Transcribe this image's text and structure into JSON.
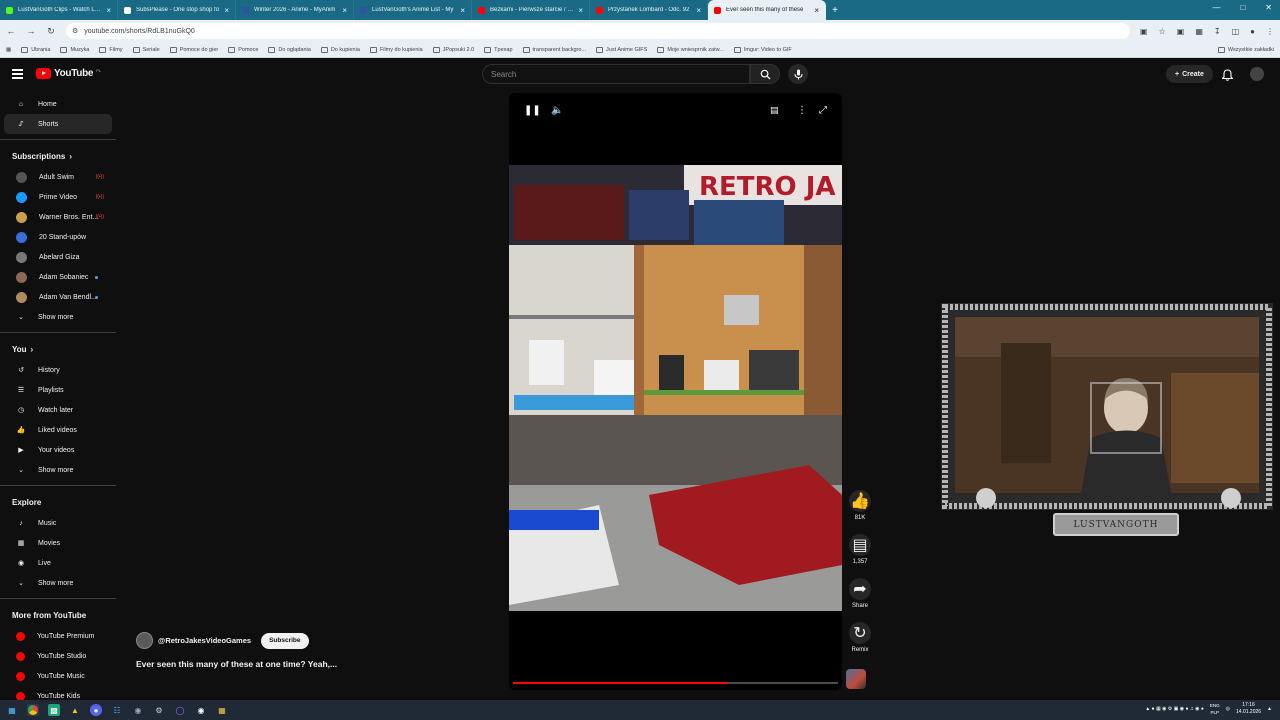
{
  "browser": {
    "tabs": [
      {
        "title": "LustVanGoth Clips - Watch Live",
        "color": "#53fc18"
      },
      {
        "title": "SubsPlease - One stop shop fo",
        "color": "#ffffff"
      },
      {
        "title": "Winter 2026 - Anime - MyAnim",
        "color": "#2e51a2"
      },
      {
        "title": "LustVanGoth's Anime List - My",
        "color": "#2e51a2"
      },
      {
        "title": "Bezkarni - Pierwsze starcie / Th",
        "color": "#ff0000"
      },
      {
        "title": "Przystanek Lombard - Odc. 92",
        "color": "#ff0000"
      },
      {
        "title": "Ever seen this many of these",
        "color": "#ff0000"
      }
    ],
    "url": "youtube.com/shorts/RdLB1nuGkQ0",
    "bookmarks": [
      "Ubrania",
      "Muzyka",
      "Filmy",
      "Seriale",
      "Pomoce do gier",
      "Pomoce",
      "Do oglądania",
      "Do kupienia",
      "Filmy do kupienia",
      "JPopsuki 2.0",
      "Tpexap",
      "transparent backgro...",
      "Just Anime GIFS",
      "Moje wniesprnik zatw...",
      "Imgur: Video to GIF"
    ],
    "bookmarks_right": "Wszystkie zakładki"
  },
  "youtube": {
    "logo_text": "YouTube",
    "country_code": "PL",
    "search_placeholder": "Search",
    "create_label": "Create"
  },
  "sidebar": {
    "main": [
      {
        "label": "Home",
        "icon": "home-icon"
      },
      {
        "label": "Shorts",
        "icon": "shorts-icon",
        "active": true
      }
    ],
    "subscriptions_heading": "Subscriptions",
    "subscriptions": [
      {
        "label": "Adult Swim",
        "badge": "live",
        "color": "#555555"
      },
      {
        "label": "Prime Video",
        "badge": "live",
        "color": "#1a98ff"
      },
      {
        "label": "Warner Bros. Ent...",
        "badge": "live",
        "color": "#c9a14a"
      },
      {
        "label": "20 Stand-upów",
        "badge": "",
        "color": "#3a6fd8"
      },
      {
        "label": "Abelard Giza",
        "badge": "",
        "color": "#777777"
      },
      {
        "label": "Adam Sobaniec",
        "badge": "dot",
        "color": "#8a6a55"
      },
      {
        "label": "Adam Van Bendl...",
        "badge": "dot",
        "color": "#b08b5e"
      }
    ],
    "show_more": "Show more",
    "you_heading": "You",
    "you_items": [
      {
        "label": "History",
        "icon": "history-icon"
      },
      {
        "label": "Playlists",
        "icon": "playlists-icon"
      },
      {
        "label": "Watch later",
        "icon": "watch-later-icon"
      },
      {
        "label": "Liked videos",
        "icon": "like-icon"
      },
      {
        "label": "Your videos",
        "icon": "your-videos-icon"
      }
    ],
    "explore_heading": "Explore",
    "explore_items": [
      {
        "label": "Music",
        "icon": "music-icon"
      },
      {
        "label": "Movies",
        "icon": "movies-icon"
      },
      {
        "label": "Live",
        "icon": "live-icon"
      }
    ],
    "more_heading": "More from YouTube",
    "more_items": [
      "YouTube Premium",
      "YouTube Studio",
      "YouTube Music",
      "YouTube Kids"
    ]
  },
  "short": {
    "progress": 0.66,
    "channel": "@RetroJakesVideoGames",
    "subscribe_label": "Subscribe",
    "title": "Ever seen this many of these at one time? Yeah,...",
    "actions": {
      "likes": "81K",
      "comments": "1,357",
      "share": "Share",
      "remix": "Remix"
    }
  },
  "webcam": {
    "name": "LUSTVANGOTH"
  },
  "taskbar": {
    "lang_top": "ENG",
    "lang_bottom": "PLP",
    "time": "17:16",
    "date": "14.01.2026"
  }
}
